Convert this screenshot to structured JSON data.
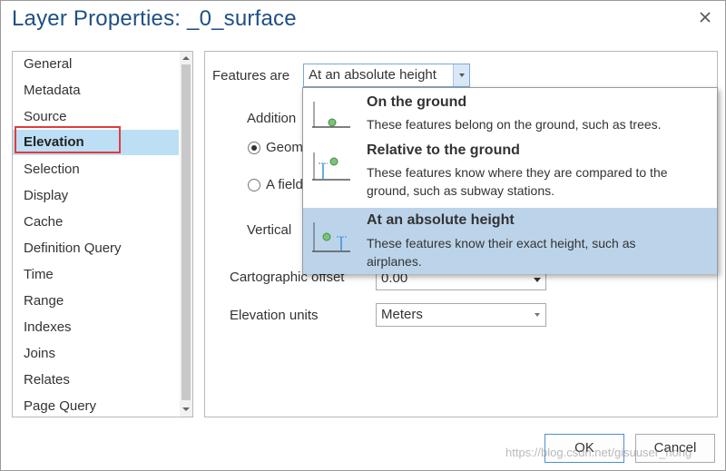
{
  "window": {
    "title": "Layer Properties: _0_surface"
  },
  "nav": {
    "items": [
      {
        "label": "General"
      },
      {
        "label": "Metadata"
      },
      {
        "label": "Source"
      },
      {
        "label": "Elevation",
        "selected": true
      },
      {
        "label": "Selection"
      },
      {
        "label": "Display"
      },
      {
        "label": "Cache"
      },
      {
        "label": "Definition Query"
      },
      {
        "label": "Time"
      },
      {
        "label": "Range"
      },
      {
        "label": "Indexes"
      },
      {
        "label": "Joins"
      },
      {
        "label": "Relates"
      },
      {
        "label": "Page Query"
      }
    ]
  },
  "content": {
    "features_are_label": "Features are",
    "features_are_value": "At an absolute height",
    "additional_label": "Addition",
    "radio_geometry_label": "Geom",
    "radio_field_label": "A field",
    "vertical_label": "Vertical",
    "cartographic_offset_label": "Cartographic offset",
    "cartographic_offset_value": "0.00",
    "elevation_units_label": "Elevation units",
    "elevation_units_value": "Meters"
  },
  "dropdown": {
    "options": [
      {
        "title": "On the ground",
        "desc_line1": "These features belong on the ground, such as trees.",
        "desc_line2": "",
        "icon": "ground-placement-icon"
      },
      {
        "title": "Relative to the ground",
        "desc_line1": "These features know where they are compared to the",
        "desc_line2": "ground, such as subway stations.",
        "icon": "relative-placement-icon"
      },
      {
        "title": "At an absolute height",
        "desc_line1": "These features know their exact height, such as",
        "desc_line2": "airplanes.",
        "icon": "absolute-placement-icon",
        "selected": true
      }
    ]
  },
  "buttons": {
    "ok": "OK",
    "cancel": "Cancel"
  },
  "watermark": "https://blog.csdn.net/gisuuser_hong",
  "colors": {
    "title": "#1e4f86",
    "selection": "#bcdff5",
    "highlight_box": "#e23c3c",
    "accent_green": "#5cb85c"
  }
}
